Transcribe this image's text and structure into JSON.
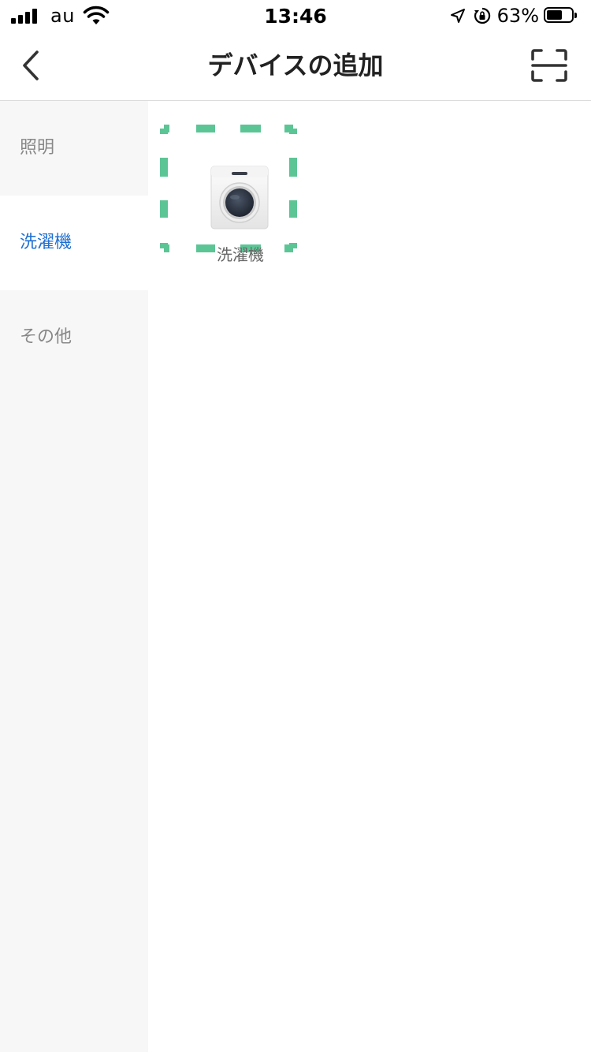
{
  "status_bar": {
    "carrier": "au",
    "time": "13:46",
    "battery_percent": "63%",
    "battery_level": 0.63,
    "icons": [
      "signal-icon",
      "wifi-icon",
      "location-arrow-icon",
      "rotation-lock-icon",
      "battery-icon"
    ]
  },
  "nav": {
    "title": "デバイスの追加",
    "back_icon": "chevron-left-icon",
    "scan_icon": "scan-frame-icon"
  },
  "sidebar": {
    "items": [
      {
        "label": "照明",
        "active": false
      },
      {
        "label": "洗濯機",
        "active": true
      },
      {
        "label": "その他",
        "active": false
      }
    ]
  },
  "main": {
    "devices": [
      {
        "label": "洗濯機",
        "icon": "washing-machine-icon",
        "highlight_color": "#5cc595"
      }
    ]
  },
  "colors": {
    "accent": "#1f6fd1",
    "highlight": "#5cc595",
    "sidebar_bg": "#f7f7f7"
  }
}
